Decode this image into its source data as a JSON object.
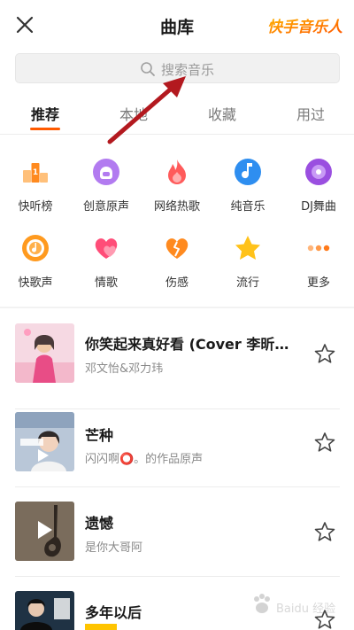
{
  "header": {
    "title": "曲库",
    "brand": "快手音乐人"
  },
  "search": {
    "placeholder": "搜索音乐"
  },
  "tabs": [
    {
      "label": "推荐",
      "active": true
    },
    {
      "label": "本地",
      "active": false
    },
    {
      "label": "收藏",
      "active": false
    },
    {
      "label": "用过",
      "active": false
    }
  ],
  "categories": [
    {
      "label": "快听榜",
      "icon": "chart-podium-icon"
    },
    {
      "label": "创意原声",
      "icon": "headphones-mic-icon"
    },
    {
      "label": "网络热歌",
      "icon": "flame-icon"
    },
    {
      "label": "纯音乐",
      "icon": "music-note-icon"
    },
    {
      "label": "DJ舞曲",
      "icon": "vinyl-disc-icon"
    },
    {
      "label": "快歌声",
      "icon": "record-icon"
    },
    {
      "label": "情歌",
      "icon": "heart-icon"
    },
    {
      "label": "伤感",
      "icon": "broken-heart-icon"
    },
    {
      "label": "流行",
      "icon": "star-icon"
    },
    {
      "label": "更多",
      "icon": "more-dots-icon"
    }
  ],
  "songs": [
    {
      "title": "你笑起来真好看 (Cover 李昕融...",
      "artist": "邓文怡&邓力玮"
    },
    {
      "title": "芒种",
      "artist": "闪闪啊⭕。的作品原声"
    },
    {
      "title": "遗憾",
      "artist": "是你大哥阿"
    },
    {
      "title": "多年以后",
      "artist": ""
    }
  ],
  "colors": {
    "accent": "#ff5a00",
    "annotation_arrow": "#b3191f"
  },
  "watermark": {
    "text": "Baidu 经验"
  }
}
